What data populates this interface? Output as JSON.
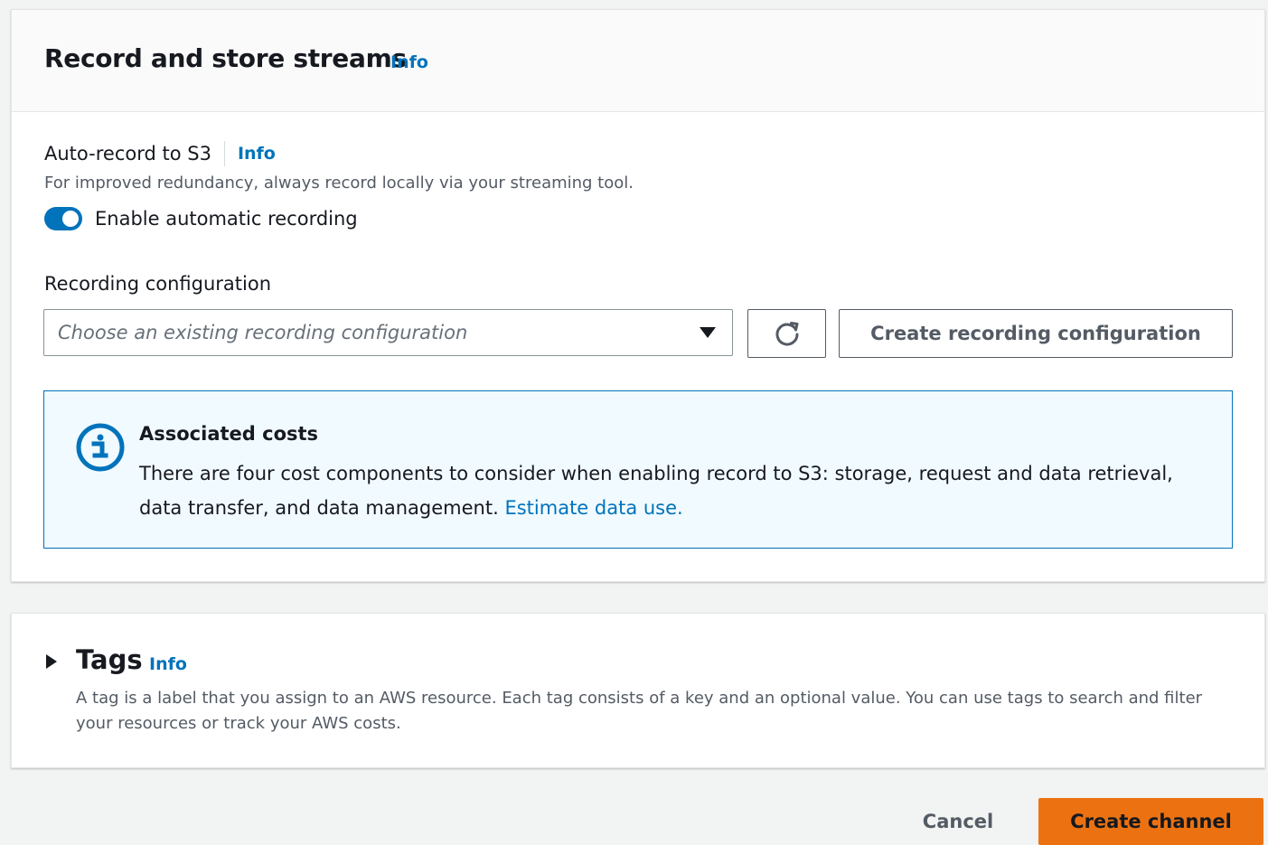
{
  "record_section": {
    "title": "Record and store streams",
    "info_label": "Info",
    "auto_record": {
      "label": "Auto-record to S3",
      "info_label": "Info",
      "description": "For improved redundancy, always record locally via your streaming tool.",
      "toggle_label": "Enable automatic recording",
      "toggle_checked": true
    },
    "recording_config": {
      "label": "Recording configuration",
      "placeholder": "Choose an existing recording configuration",
      "refresh_icon": "refresh-icon",
      "create_button_label": "Create recording configuration"
    },
    "alert": {
      "icon": "info-circle-icon",
      "title": "Associated costs",
      "body": "There are four cost components to consider when enabling record to S3: storage, request and data retrieval, data transfer, and data management.",
      "link_label": "Estimate data use."
    }
  },
  "tags_section": {
    "title": "Tags",
    "info_label": "Info",
    "expanded": false,
    "description": "A tag is a label that you assign to an AWS resource. Each tag consists of a key and an optional value. You can use tags to search and filter your resources or track your AWS costs."
  },
  "footer": {
    "cancel_label": "Cancel",
    "submit_label": "Create channel"
  },
  "colors": {
    "accent": "#0073bb",
    "primary_button": "#ec7211",
    "alert_background": "#f1faff"
  }
}
